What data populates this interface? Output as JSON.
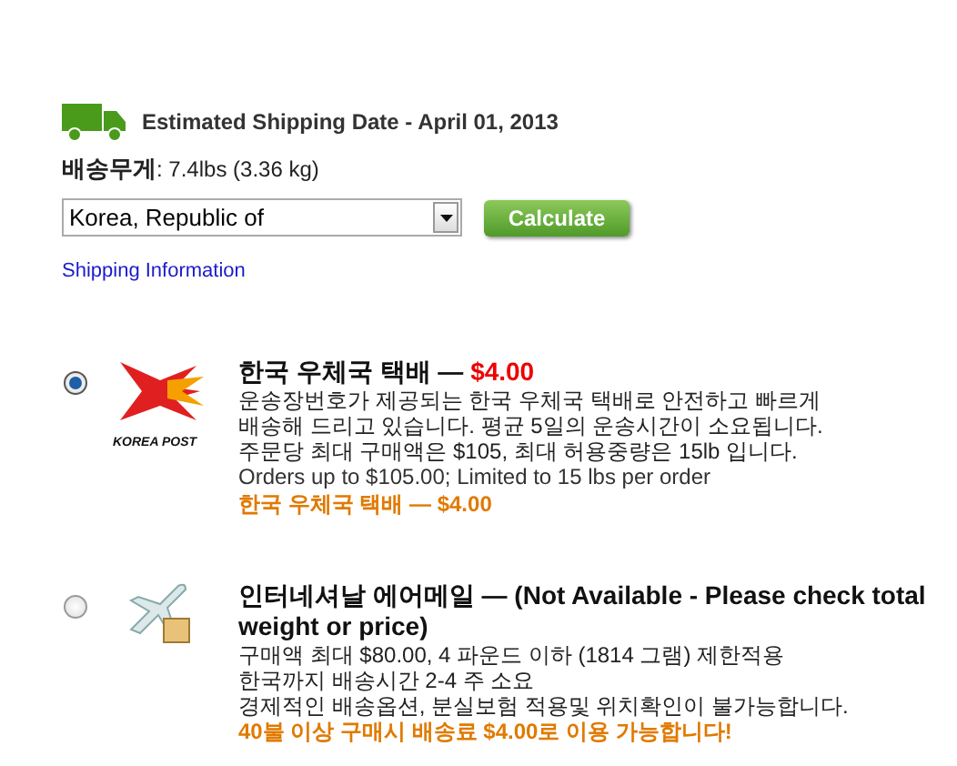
{
  "shipping_date": "Estimated Shipping Date - April 01, 2013",
  "weight": {
    "label": "배송무게",
    "value": ": 7.4lbs (3.36 kg)"
  },
  "country_select": {
    "value": "Korea, Republic of"
  },
  "calculate_button": "Calculate",
  "shipping_info_link": "Shipping Information",
  "options": [
    {
      "kind": "korea-post",
      "selected": true,
      "logo_text": "KOREA POST",
      "name": "한국 우체국 택배 — ",
      "price": "$4.00",
      "lines": [
        "운송장번호가 제공되는 한국 우체국 택배로 안전하고 빠르게",
        "배송해 드리고 있습니다. 평균 5일의 운송시간이 소요됩니다.",
        "주문당 최대 구매액은 $105, 최대 허용중량은 15lb 입니다."
      ],
      "limit": "Orders up to $105.00; Limited to 15 lbs per order",
      "promo": "한국 우체국 택배 — $4.00"
    },
    {
      "kind": "airmail",
      "selected": false,
      "name": "인터네셔날 에어메일 — ",
      "note": "(Not Available - Please check total weight or price)",
      "lines": [
        "구매액 최대 $80.00, 4 파운드 이하 (1814 그램) 제한적용",
        "한국까지 배송시간 2-4 주 소요",
        "경제적인 배송옵션, 분실보험 적용및 위치확인이 불가능합니다."
      ],
      "promo": "40불 이상 구매시 배송료 $4.00로 이용 가능합니다!"
    }
  ]
}
